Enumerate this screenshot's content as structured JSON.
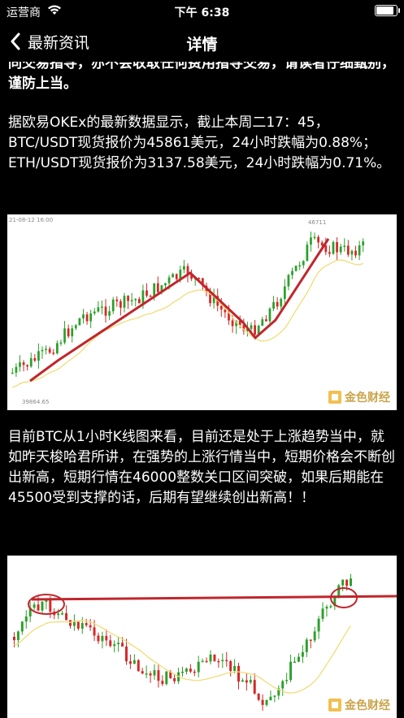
{
  "status_bar": {
    "carrier": "运营商",
    "time": "下午 6:38",
    "battery_level": 0.95
  },
  "nav": {
    "back_label": "最新资讯",
    "title": "详情"
  },
  "article": {
    "paragraph_top": "同交易指导，亦不会收取任何费用指导交易，请读者仔细甄别，谨防上当。",
    "paragraph_1": "据欧易OKEx的最新数据显示，截止本周二17：45，BTC/USDT现货报价为45861美元，24小时跌幅为0.88%；ETH/USDT现货报价为3137.58美元，24小时跌幅为0.71%。",
    "paragraph_2": "目前BTC从1小时K线图来看，目前还是处于上涨趋势当中，就如昨天梭哈君所讲，在强势的上涨行情当中，短期价格会不断创出新高，短期行情在46000整数关口区间突破，如果后期能在45500受到支撑的话，后期有望继续创出新高！！"
  },
  "chart1": {
    "watermark": "金色财经",
    "date_label": "21-08-12 16:00",
    "high_label": "46711",
    "low_label": "39864.65"
  },
  "chart2": {
    "watermark": "金色财经"
  },
  "colors": {
    "up": "#2ca02c",
    "down": "#d62728",
    "trend": "#c0262c",
    "ma": "#f0dc78"
  }
}
